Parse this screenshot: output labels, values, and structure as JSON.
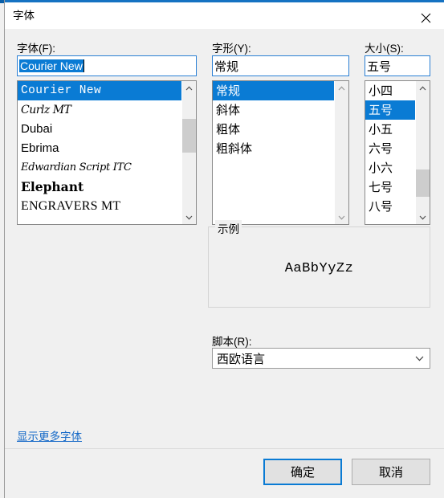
{
  "window": {
    "title": "字体",
    "close_icon": "close-icon"
  },
  "font": {
    "label": "字体(F):",
    "input_value": "Courier New",
    "items": [
      {
        "name": "Courier New",
        "style": "courier",
        "selected": true
      },
      {
        "name": "Curlz MT",
        "style": "curlz",
        "selected": false
      },
      {
        "name": "Dubai",
        "style": "plain",
        "selected": false
      },
      {
        "name": "Ebrima",
        "style": "plain",
        "selected": false
      },
      {
        "name": "Edwardian Script ITC",
        "style": "script",
        "selected": false
      },
      {
        "name": "Elephant",
        "style": "elephant",
        "selected": false
      },
      {
        "name": "ENGRAVERS MT",
        "style": "engravers",
        "selected": false
      }
    ]
  },
  "style": {
    "label": "字形(Y):",
    "input_value": "常规",
    "items": [
      {
        "name": "常规",
        "selected": true
      },
      {
        "name": "斜体",
        "selected": false
      },
      {
        "name": "粗体",
        "selected": false
      },
      {
        "name": "粗斜体",
        "selected": false
      }
    ]
  },
  "size": {
    "label": "大小(S):",
    "input_value": "五号",
    "items": [
      {
        "name": "小四",
        "selected": false
      },
      {
        "name": "五号",
        "selected": true
      },
      {
        "name": "小五",
        "selected": false
      },
      {
        "name": "六号",
        "selected": false
      },
      {
        "name": "小六",
        "selected": false
      },
      {
        "name": "七号",
        "selected": false
      },
      {
        "name": "八号",
        "selected": false
      }
    ]
  },
  "sample": {
    "legend": "示例",
    "text": "AaBbYyZz"
  },
  "script": {
    "label": "脚本(R):",
    "value": "西欧语言"
  },
  "links": {
    "more_fonts": "显示更多字体"
  },
  "buttons": {
    "ok": "确定",
    "cancel": "取消"
  },
  "colors": {
    "accent": "#0a7bd4",
    "title_border": "#1572c2",
    "dialog_bg": "#f0f0f0",
    "link": "#1569c7",
    "scroll_thumb": "#cdcdcd"
  }
}
